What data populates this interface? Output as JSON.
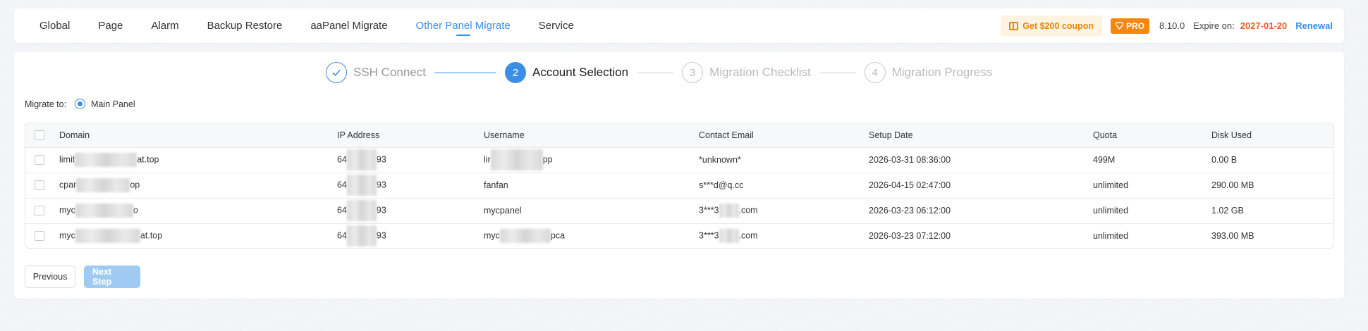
{
  "tabs": [
    {
      "label": "Global",
      "active": false
    },
    {
      "label": "Page",
      "active": false
    },
    {
      "label": "Alarm",
      "active": false
    },
    {
      "label": "Backup Restore",
      "active": false
    },
    {
      "label": "aaPanel Migrate",
      "active": false
    },
    {
      "label": "Other Panel Migrate",
      "active": true
    },
    {
      "label": "Service",
      "active": false
    }
  ],
  "header": {
    "coupon_label": "Get $200 coupon",
    "pro_label": "PRO",
    "version": "8.10.0",
    "expire_label": "Expire on:",
    "expire_date": "2027-01-20",
    "renewal_label": "Renewal"
  },
  "steps": [
    {
      "number": "✓",
      "label": "SSH Connect",
      "state": "done"
    },
    {
      "number": "2",
      "label": "Account Selection",
      "state": "current"
    },
    {
      "number": "3",
      "label": "Migration Checklist",
      "state": "todo"
    },
    {
      "number": "4",
      "label": "Migration Progress",
      "state": "todo"
    }
  ],
  "migrate": {
    "label": "Migrate to:",
    "option": "Main Panel"
  },
  "table": {
    "columns": [
      "Domain",
      "IP Address",
      "Username",
      "Contact Email",
      "Setup Date",
      "Quota",
      "Disk Used"
    ],
    "rows": [
      {
        "domain_a": "limit",
        "domain_b": "at.top",
        "ip_a": "64",
        "ip_b": "93",
        "user_a": "lir",
        "user_b": "pp",
        "email": "*unknown*",
        "date": "2026-03-31 08:36:00",
        "quota": "499M",
        "disk": "0.00 B"
      },
      {
        "domain_a": "cpar",
        "domain_b": "op",
        "ip_a": "64",
        "ip_b": "93",
        "user_a": "fanfan",
        "user_b": "",
        "email": "s***d@q.cc",
        "date": "2026-04-15 02:47:00",
        "quota": "unlimited",
        "disk": "290.00 MB"
      },
      {
        "domain_a": "myc",
        "domain_b": "o",
        "ip_a": "64",
        "ip_b": "93",
        "user_a": "mycpanel",
        "user_b": "",
        "email_a": "3***3",
        "email_b": ".com",
        "date": "2026-03-23 06:12:00",
        "quota": "unlimited",
        "disk": "1.02 GB"
      },
      {
        "domain_a": "myc",
        "domain_b": "at.top",
        "ip_a": "64",
        "ip_b": "93",
        "user_a": "myc",
        "user_b": "pca",
        "email_a": "3***3",
        "email_b": ".com",
        "date": "2026-03-23 07:12:00",
        "quota": "unlimited",
        "disk": "393.00 MB"
      }
    ]
  },
  "buttons": {
    "previous": "Previous",
    "next": "Next Step"
  },
  "colors": {
    "accent": "#3a8ee6",
    "pro": "#f7860f",
    "expire": "#f05b24",
    "coupon_text": "#e8850c"
  }
}
